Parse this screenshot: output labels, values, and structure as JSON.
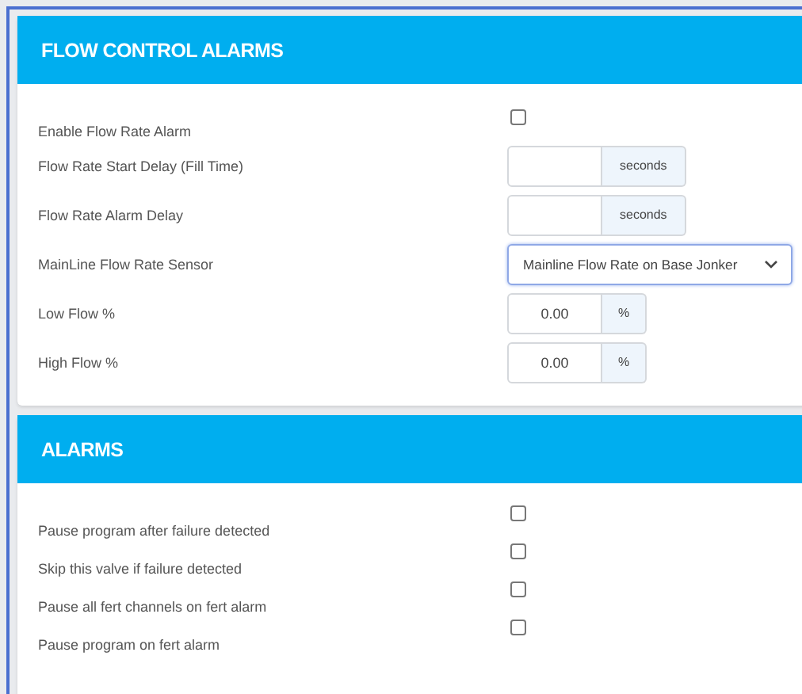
{
  "sections": [
    {
      "title": "FLOW CONTROL ALARMS",
      "rows": [
        {
          "kind": "checkbox",
          "label": "Enable Flow Rate Alarm",
          "checked": false
        },
        {
          "kind": "input",
          "label": "Flow Rate Start Delay (Fill Time)",
          "addon": "seconds"
        },
        {
          "kind": "input",
          "label": "Flow Rate Alarm Delay",
          "addon": "seconds"
        },
        {
          "kind": "select",
          "label": "MainLine Flow Rate Sensor",
          "value": "Mainline Flow Rate on Base Jonker"
        },
        {
          "kind": "input",
          "label": "Low Flow %",
          "value": "0.00",
          "addon": "%"
        },
        {
          "kind": "input",
          "label": "High Flow %",
          "value": "0.00",
          "addon": "%"
        }
      ]
    },
    {
      "title": "ALARMS",
      "rows": [
        {
          "kind": "checkbox",
          "label": "Pause program after failure detected",
          "checked": false
        },
        {
          "kind": "checkbox",
          "label": "Skip this valve if failure detected",
          "checked": false
        },
        {
          "kind": "checkbox",
          "label": "Pause all fert channels on fert alarm",
          "checked": false
        },
        {
          "kind": "checkbox",
          "label": "Pause program on fert alarm",
          "checked": false
        }
      ]
    }
  ]
}
